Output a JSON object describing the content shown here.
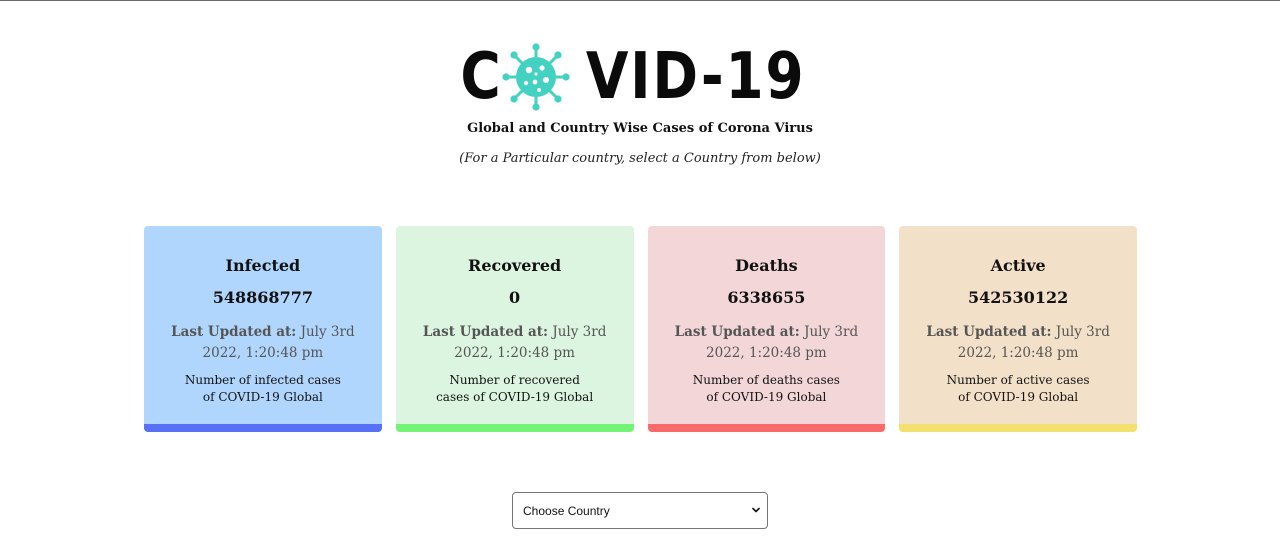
{
  "header": {
    "logo_left": "C",
    "logo_right": "VID-19",
    "virus_icon": "coronavirus-icon",
    "subtitle": "Global and Country Wise Cases of Corona Virus",
    "hint": "(For a Particular country, select a Country from below)"
  },
  "colors": {
    "infected_bg": "#b0d6fd",
    "infected_bar": "#5870f7",
    "recovered_bg": "#dcf5e0",
    "recovered_bar": "#74f474",
    "deaths_bg": "#f2d6d8",
    "deaths_bar": "#fb6a6a",
    "active_bg": "#f3e0c8",
    "active_bar": "#f2e16e",
    "virus": "#43d1c2"
  },
  "cards": [
    {
      "title": "Infected",
      "value": "548868777",
      "updated_label": "Last Updated at:",
      "updated_value": "July 3rd 2022, 1:20:48 pm",
      "description": "Number of infected cases of COVID-19 Global"
    },
    {
      "title": "Recovered",
      "value": "0",
      "updated_label": "Last Updated at:",
      "updated_value": "July 3rd 2022, 1:20:48 pm",
      "description": "Number of recovered cases of COVID-19 Global"
    },
    {
      "title": "Deaths",
      "value": "6338655",
      "updated_label": "Last Updated at:",
      "updated_value": "July 3rd 2022, 1:20:48 pm",
      "description": "Number of deaths cases of COVID-19 Global"
    },
    {
      "title": "Active",
      "value": "542530122",
      "updated_label": "Last Updated at:",
      "updated_value": "July 3rd 2022, 1:20:48 pm",
      "description": "Number of active cases of COVID-19 Global"
    }
  ],
  "country_select": {
    "selected": "Choose Country",
    "chevron_icon": "chevron-down-icon"
  }
}
